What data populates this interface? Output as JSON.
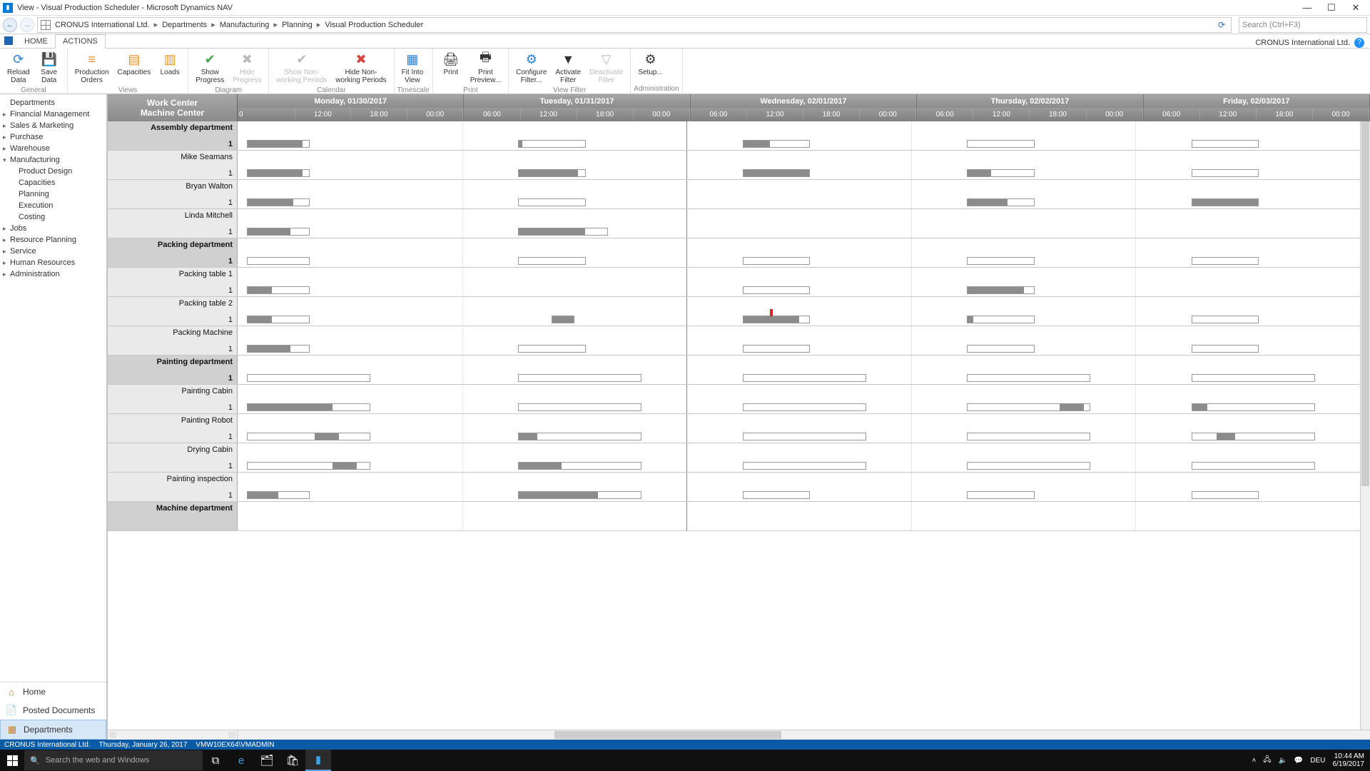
{
  "window": {
    "title": "View - Visual Production Scheduler - Microsoft Dynamics NAV",
    "company_header": "CRONUS International Ltd."
  },
  "breadcrumb": {
    "root": "CRONUS International Ltd.",
    "items": [
      "Departments",
      "Manufacturing",
      "Planning",
      "Visual Production Scheduler"
    ],
    "search_placeholder": "Search (Ctrl+F3)"
  },
  "ribbon_tabs": {
    "home": "HOME",
    "actions": "ACTIONS"
  },
  "ribbon": {
    "general": {
      "label": "General",
      "reload": "Reload\nData",
      "save": "Save\nData"
    },
    "views": {
      "label": "Views",
      "orders": "Production\nOrders",
      "capacities": "Capacities",
      "loads": "Loads"
    },
    "diagram": {
      "label": "Diagram",
      "show": "Show\nProgress",
      "hide": "Hide\nProgress"
    },
    "calendar": {
      "label": "Calendar",
      "shownon": "Show Non-\nworking Periods",
      "hidenon": "Hide Non-\nworking Periods"
    },
    "timescale": {
      "label": "Timescale",
      "fit": "Fit Into\nView"
    },
    "print": {
      "label": "Print",
      "print": "Print",
      "preview": "Print\nPreview..."
    },
    "viewfilter": {
      "label": "View Filter",
      "configure": "Configure\nFilter...",
      "activate": "Activate\nFilter",
      "deactivate": "Deactivate\nFilter"
    },
    "admin": {
      "label": "Administration",
      "setup": "Setup..."
    }
  },
  "sidebar": {
    "tree": [
      {
        "label": "Departments",
        "level": 1
      },
      {
        "label": "Financial Management",
        "level": 1,
        "expandable": true
      },
      {
        "label": "Sales & Marketing",
        "level": 1,
        "expandable": true
      },
      {
        "label": "Purchase",
        "level": 1,
        "expandable": true
      },
      {
        "label": "Warehouse",
        "level": 1,
        "expandable": true
      },
      {
        "label": "Manufacturing",
        "level": 1,
        "expanded": true
      },
      {
        "label": "Product Design",
        "level": 2
      },
      {
        "label": "Capacities",
        "level": 2
      },
      {
        "label": "Planning",
        "level": 2
      },
      {
        "label": "Execution",
        "level": 2
      },
      {
        "label": "Costing",
        "level": 2
      },
      {
        "label": "Jobs",
        "level": 1,
        "expandable": true
      },
      {
        "label": "Resource Planning",
        "level": 1,
        "expandable": true
      },
      {
        "label": "Service",
        "level": 1,
        "expandable": true
      },
      {
        "label": "Human Resources",
        "level": 1,
        "expandable": true
      },
      {
        "label": "Administration",
        "level": 1,
        "expandable": true
      }
    ],
    "bottom": {
      "home": "Home",
      "posted": "Posted Documents",
      "departments": "Departments"
    }
  },
  "scheduler": {
    "header": {
      "line1": "Work Center",
      "line2": "Machine Center"
    },
    "days": [
      "Monday, 01/30/2017",
      "Tuesday, 01/31/2017",
      "Wednesday, 02/01/2017",
      "Thursday, 02/02/2017",
      "Friday, 02/03/2017"
    ],
    "hours": [
      "0",
      "12:00",
      "18:00",
      "00:00",
      "06:00",
      "12:00",
      "18:00",
      "00:00",
      "06:00",
      "12:00",
      "18:00",
      "00:00",
      "06:00",
      "12:00",
      "18:00",
      "00:00",
      "06:00",
      "12:00",
      "18:00",
      "00:00"
    ],
    "rows": [
      {
        "name": "Assembly department",
        "cap": "1",
        "group": true,
        "bars": [
          {
            "d": 0,
            "s": 0.04,
            "w": 0.28,
            "f": 0.9
          },
          {
            "d": 1,
            "s": 0.25,
            "w": 0.3,
            "f": 0.05
          },
          {
            "d": 2,
            "s": 0.25,
            "w": 0.3,
            "f": 0.4
          },
          {
            "d": 3,
            "s": 0.25,
            "w": 0.3,
            "f": 0
          },
          {
            "d": 4,
            "s": 0.25,
            "w": 0.3,
            "f": 0
          }
        ]
      },
      {
        "name": "Mike Seamans",
        "cap": "1",
        "bars": [
          {
            "d": 0,
            "s": 0.04,
            "w": 0.28,
            "f": 0.9
          },
          {
            "d": 1,
            "s": 0.25,
            "w": 0.3,
            "f": 0.9
          },
          {
            "d": 2,
            "s": 0.25,
            "w": 0.3,
            "f": 1.0
          },
          {
            "d": 3,
            "s": 0.25,
            "w": 0.3,
            "f": 0.35
          },
          {
            "d": 4,
            "s": 0.25,
            "w": 0.3,
            "f": 0
          }
        ]
      },
      {
        "name": "Bryan Walton",
        "cap": "1",
        "bars": [
          {
            "d": 0,
            "s": 0.04,
            "w": 0.28,
            "f": 0.75
          },
          {
            "d": 1,
            "s": 0.25,
            "w": 0.3,
            "f": 0
          },
          {
            "d": 3,
            "s": 0.25,
            "w": 0.3,
            "f": 0.6
          },
          {
            "d": 4,
            "s": 0.25,
            "w": 0.3,
            "f": 1.0
          }
        ]
      },
      {
        "name": "Linda Mitchell",
        "cap": "1",
        "bars": [
          {
            "d": 0,
            "s": 0.04,
            "w": 0.28,
            "f": 0.7
          },
          {
            "d": 1,
            "s": 0.25,
            "w": 0.4,
            "f": 0.75
          }
        ]
      },
      {
        "name": "Packing department",
        "cap": "1",
        "group": true,
        "bars": [
          {
            "d": 0,
            "s": 0.04,
            "w": 0.28,
            "f": 0
          },
          {
            "d": 1,
            "s": 0.25,
            "w": 0.3,
            "f": 0
          },
          {
            "d": 2,
            "s": 0.25,
            "w": 0.3,
            "f": 0
          },
          {
            "d": 3,
            "s": 0.25,
            "w": 0.3,
            "f": 0
          },
          {
            "d": 4,
            "s": 0.25,
            "w": 0.3,
            "f": 0
          }
        ]
      },
      {
        "name": "Packing table 1",
        "cap": "1",
        "bars": [
          {
            "d": 0,
            "s": 0.04,
            "w": 0.28,
            "f": 0.4
          },
          {
            "d": 2,
            "s": 0.25,
            "w": 0.3,
            "f": 0
          },
          {
            "d": 3,
            "s": 0.25,
            "w": 0.3,
            "f": 0.85
          }
        ]
      },
      {
        "name": "Packing table 2",
        "cap": "1",
        "bars": [
          {
            "d": 0,
            "s": 0.04,
            "w": 0.28,
            "f": 0.4
          },
          {
            "d": 1,
            "s": 0.4,
            "w": 0.1,
            "f": 1.0
          },
          {
            "d": 2,
            "s": 0.25,
            "w": 0.3,
            "f": 0.85,
            "marker": 0.4
          },
          {
            "d": 3,
            "s": 0.25,
            "w": 0.3,
            "f": 0.08
          },
          {
            "d": 4,
            "s": 0.25,
            "w": 0.3,
            "f": 0
          }
        ]
      },
      {
        "name": "Packing Machine",
        "cap": "1",
        "bars": [
          {
            "d": 0,
            "s": 0.04,
            "w": 0.28,
            "f": 0.7
          },
          {
            "d": 1,
            "s": 0.25,
            "w": 0.3,
            "f": 0
          },
          {
            "d": 2,
            "s": 0.25,
            "w": 0.3,
            "f": 0
          },
          {
            "d": 3,
            "s": 0.25,
            "w": 0.3,
            "f": 0
          },
          {
            "d": 4,
            "s": 0.25,
            "w": 0.3,
            "f": 0
          }
        ]
      },
      {
        "name": "Painting department",
        "cap": "1",
        "group": true,
        "bars": [
          {
            "d": 0,
            "s": 0.04,
            "w": 0.55,
            "f": 0
          },
          {
            "d": 1,
            "s": 0.25,
            "w": 0.55,
            "f": 0
          },
          {
            "d": 2,
            "s": 0.25,
            "w": 0.55,
            "f": 0
          },
          {
            "d": 3,
            "s": 0.25,
            "w": 0.55,
            "f": 0
          },
          {
            "d": 4,
            "s": 0.25,
            "w": 0.55,
            "f": 0
          }
        ]
      },
      {
        "name": "Painting Cabin",
        "cap": "1",
        "bars": [
          {
            "d": 0,
            "s": 0.04,
            "w": 0.55,
            "f": 0.7
          },
          {
            "d": 1,
            "s": 0.25,
            "w": 0.55,
            "f": 0
          },
          {
            "d": 2,
            "s": 0.25,
            "w": 0.55,
            "f": 0
          },
          {
            "d": 3,
            "s": 0.25,
            "w": 0.55,
            "f": 0.2,
            "fillStart": 0.75
          },
          {
            "d": 4,
            "s": 0.25,
            "w": 0.55,
            "f": 0.12
          }
        ]
      },
      {
        "name": "Painting Robot",
        "cap": "1",
        "bars": [
          {
            "d": 0,
            "s": 0.04,
            "w": 0.55,
            "f": 0.2,
            "fillStart": 0.55
          },
          {
            "d": 1,
            "s": 0.25,
            "w": 0.55,
            "f": 0.15
          },
          {
            "d": 2,
            "s": 0.25,
            "w": 0.55,
            "f": 0
          },
          {
            "d": 3,
            "s": 0.25,
            "w": 0.55,
            "f": 0
          },
          {
            "d": 4,
            "s": 0.25,
            "w": 0.55,
            "f": 0.15,
            "fillStart": 0.2
          }
        ]
      },
      {
        "name": "Drying Cabin",
        "cap": "1",
        "bars": [
          {
            "d": 0,
            "s": 0.04,
            "w": 0.55,
            "f": 0.2,
            "fillStart": 0.7
          },
          {
            "d": 1,
            "s": 0.25,
            "w": 0.55,
            "f": 0.35
          },
          {
            "d": 2,
            "s": 0.25,
            "w": 0.55,
            "f": 0
          },
          {
            "d": 3,
            "s": 0.25,
            "w": 0.55,
            "f": 0
          },
          {
            "d": 4,
            "s": 0.25,
            "w": 0.55,
            "f": 0
          }
        ]
      },
      {
        "name": "Painting inspection",
        "cap": "1",
        "bars": [
          {
            "d": 0,
            "s": 0.04,
            "w": 0.28,
            "f": 0.5
          },
          {
            "d": 1,
            "s": 0.25,
            "w": 0.55,
            "f": 0.65
          },
          {
            "d": 2,
            "s": 0.25,
            "w": 0.3,
            "f": 0
          },
          {
            "d": 3,
            "s": 0.25,
            "w": 0.3,
            "f": 0
          },
          {
            "d": 4,
            "s": 0.25,
            "w": 0.3,
            "f": 0
          }
        ]
      },
      {
        "name": "Machine department",
        "cap": "",
        "group": true,
        "bars": []
      }
    ],
    "now_day": 2,
    "now_frac": 0.0
  },
  "status": {
    "company": "CRONUS International Ltd.",
    "date": "Thursday, January 26, 2017",
    "host": "VMW10EX64\\VMADMIN"
  },
  "taskbar": {
    "search_placeholder": "Search the web and Windows",
    "lang": "DEU",
    "time": "10:44 AM",
    "date": "6/19/2017"
  }
}
